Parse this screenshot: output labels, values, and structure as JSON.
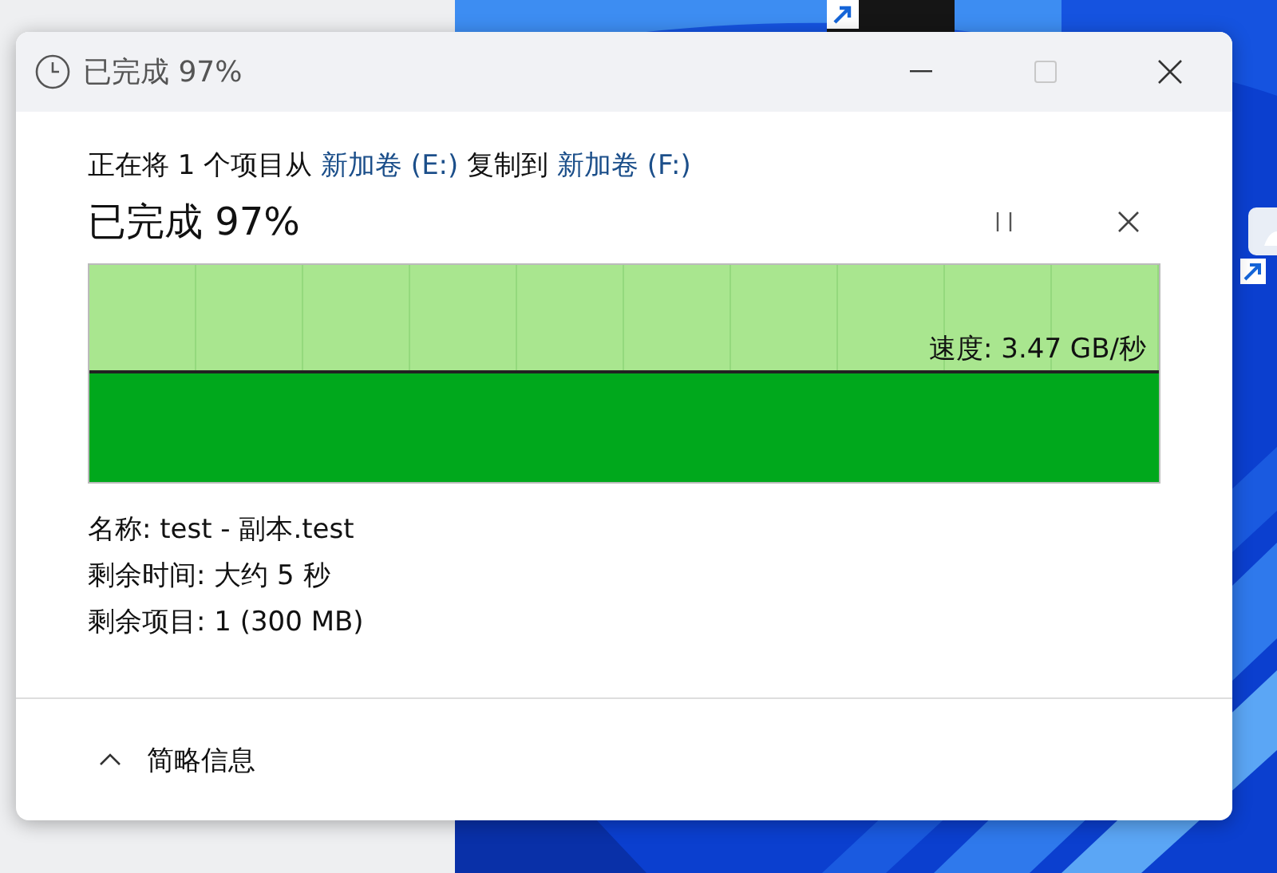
{
  "window": {
    "title": "已完成 97%",
    "buttons": [
      {
        "kind": "minimize",
        "disabled": false
      },
      {
        "kind": "maximize",
        "disabled": true
      },
      {
        "kind": "close",
        "disabled": false
      }
    ]
  },
  "header": {
    "parts": [
      {
        "kind": "plain",
        "text": "正在将 1 个项目从 "
      },
      {
        "kind": "link",
        "text": "新加卷 (E:)"
      },
      {
        "kind": "plain",
        "text": " 复制到 "
      },
      {
        "kind": "link",
        "text": "新加卷 (F:)"
      }
    ]
  },
  "progress": {
    "title": "已完成 97%",
    "speed": "速度: 3.47 GB/秒"
  },
  "details": [
    "名称: test - 副本.test",
    "剩余时间: 大约 5 秒",
    "剩余项目: 1 (300 MB)"
  ],
  "footer": {
    "toggle": "简略信息",
    "expanded": true
  }
}
